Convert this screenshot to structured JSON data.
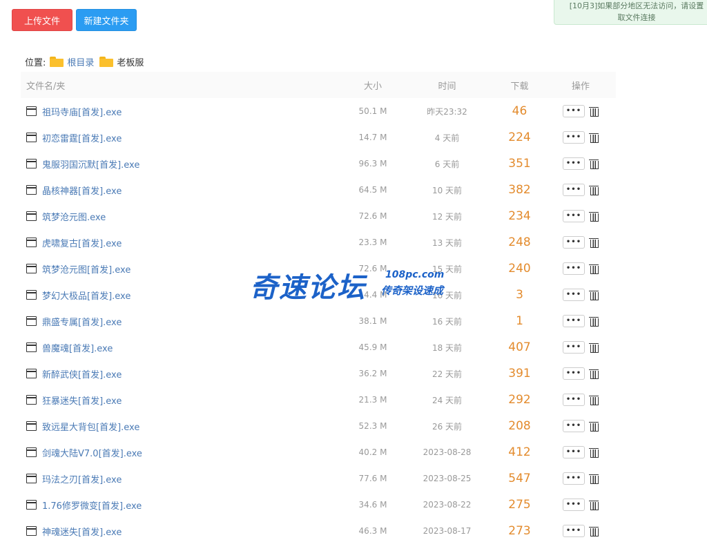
{
  "toolbar": {
    "upload_label": "上传文件",
    "newfolder_label": "新建文件夹"
  },
  "notice": {
    "line1": "[10月3]如果部分地区无法访问，请设置 ",
    "line2": "取文件连接"
  },
  "breadcrumb": {
    "label": "位置:",
    "root": "根目录",
    "current": "老板服"
  },
  "table": {
    "headers": {
      "name": "文件名/夹",
      "size": "大小",
      "time": "时间",
      "downloads": "下载",
      "actions": "操作"
    },
    "more_label": "•••",
    "rows": [
      {
        "name": "祖玛寺庙[首发].exe",
        "size": "50.1 M",
        "time": "昨天23:32",
        "downloads": "46"
      },
      {
        "name": "初恋雷霆[首发].exe",
        "size": "14.7 M",
        "time": "4 天前",
        "downloads": "224"
      },
      {
        "name": "鬼服羽国沉默[首发].exe",
        "size": "96.3 M",
        "time": "6 天前",
        "downloads": "351"
      },
      {
        "name": "晶核神器[首发].exe",
        "size": "64.5 M",
        "time": "10 天前",
        "downloads": "382"
      },
      {
        "name": "筑梦沧元图.exe",
        "size": "72.6 M",
        "time": "12 天前",
        "downloads": "234"
      },
      {
        "name": "虎啸复古[首发].exe",
        "size": "23.3 M",
        "time": "13 天前",
        "downloads": "248"
      },
      {
        "name": "筑梦沧元图[首发].exe",
        "size": "72.6 M",
        "time": "15 天前",
        "downloads": "240"
      },
      {
        "name": "梦幻大极品[首发].exe",
        "size": "64.4 M",
        "time": "16 天前",
        "downloads": "3"
      },
      {
        "name": "鼎盛专属[首发].exe",
        "size": "38.1 M",
        "time": "16 天前",
        "downloads": "1"
      },
      {
        "name": "兽魔魂[首发].exe",
        "size": "45.9 M",
        "time": "18 天前",
        "downloads": "407"
      },
      {
        "name": "新醉武侠[首发].exe",
        "size": "36.2 M",
        "time": "22 天前",
        "downloads": "391"
      },
      {
        "name": "狂暴迷失[首发].exe",
        "size": "21.3 M",
        "time": "24 天前",
        "downloads": "292"
      },
      {
        "name": "致远星大背包[首发].exe",
        "size": "52.3 M",
        "time": "26 天前",
        "downloads": "208"
      },
      {
        "name": "剑魂大陆V7.0[首发].exe",
        "size": "40.2 M",
        "time": "2023-08-28",
        "downloads": "412"
      },
      {
        "name": "玛法之刃[首发].exe",
        "size": "77.6 M",
        "time": "2023-08-25",
        "downloads": "547"
      },
      {
        "name": "1.76修罗微变[首发].exe",
        "size": "34.6 M",
        "time": "2023-08-22",
        "downloads": "275"
      },
      {
        "name": "神魂迷失[首发].exe",
        "size": "46.3 M",
        "time": "2023-08-17",
        "downloads": "273"
      }
    ]
  },
  "watermark": {
    "main": "奇速论坛",
    "url": "108pc.com",
    "sub": "传奇架设速成"
  },
  "colors": {
    "upload_button": "#f0504f",
    "newfolder_button": "#2b9cf2",
    "link": "#4a7ab5",
    "download_count": "#e38b2d",
    "watermark": "#1c62c8"
  }
}
